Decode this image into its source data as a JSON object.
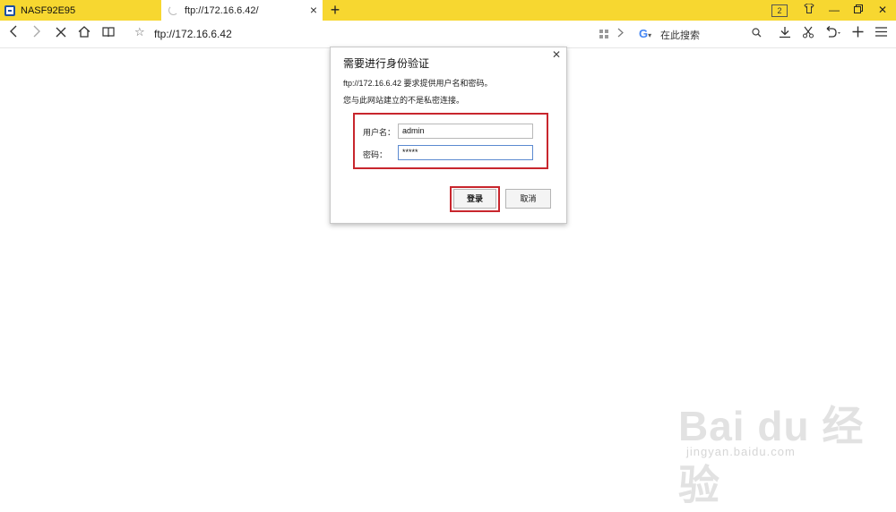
{
  "tabs": [
    {
      "title": "NASF92E95"
    },
    {
      "title": "ftp://172.16.6.42/"
    }
  ],
  "toolbar": {
    "tab_count": "2",
    "url": "ftp://172.16.6.42",
    "search_placeholder": "在此搜索"
  },
  "dialog": {
    "title": "需要进行身份验证",
    "message": "ftp://172.16.6.42 要求提供用户名和密码。",
    "warning": "您与此网站建立的不是私密连接。",
    "username_label": "用户名：",
    "username_value": "admin",
    "password_label": "密码：",
    "password_value": "*****",
    "login_label": "登录",
    "cancel_label": "取消"
  },
  "watermark": {
    "main": "Bai du 经验",
    "sub": "jingyan.baidu.com"
  },
  "colors": {
    "tabbar": "#f7d730",
    "highlight": "#c8262d"
  }
}
